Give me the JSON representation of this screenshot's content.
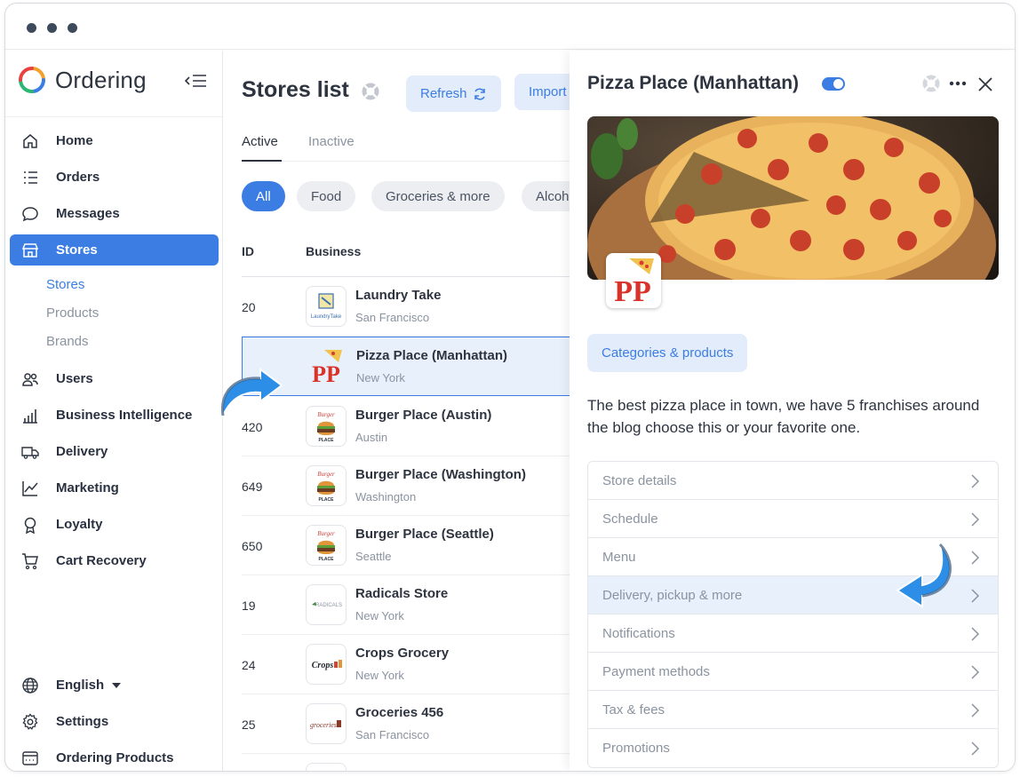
{
  "brand": {
    "name": "Ordering"
  },
  "sidebar": {
    "items": [
      {
        "label": "Home",
        "icon": "home-icon"
      },
      {
        "label": "Orders",
        "icon": "list-icon"
      },
      {
        "label": "Messages",
        "icon": "chat-icon"
      },
      {
        "label": "Stores",
        "icon": "store-icon",
        "active": true
      },
      {
        "label": "Users",
        "icon": "users-icon"
      },
      {
        "label": "Business Intelligence",
        "icon": "bar-chart-icon"
      },
      {
        "label": "Delivery",
        "icon": "truck-icon"
      },
      {
        "label": "Marketing",
        "icon": "line-chart-icon"
      },
      {
        "label": "Loyalty",
        "icon": "award-icon"
      },
      {
        "label": "Cart Recovery",
        "icon": "cart-icon"
      }
    ],
    "sub_items": [
      "Stores",
      "Products",
      "Brands"
    ],
    "footer": {
      "language": "English",
      "settings": "Settings",
      "products": "Ordering Products"
    }
  },
  "main": {
    "title": "Stores list",
    "refresh_label": "Refresh",
    "import_label": "Import",
    "tabs": [
      "Active",
      "Inactive"
    ],
    "chips": [
      "All",
      "Food",
      "Groceries & more",
      "Alcohol"
    ],
    "columns": {
      "id": "ID",
      "business": "Business"
    },
    "rows": [
      {
        "id": "20",
        "name": "Laundry Take",
        "city": "San Francisco"
      },
      {
        "id": "",
        "name": "Pizza Place (Manhattan)",
        "city": "New York"
      },
      {
        "id": "420",
        "name": "Burger Place (Austin)",
        "city": "Austin"
      },
      {
        "id": "649",
        "name": "Burger Place (Washington)",
        "city": "Washington"
      },
      {
        "id": "650",
        "name": "Burger Place (Seattle)",
        "city": "Seattle"
      },
      {
        "id": "19",
        "name": "Radicals Store",
        "city": "New York"
      },
      {
        "id": "24",
        "name": "Crops Grocery",
        "city": "New York"
      },
      {
        "id": "25",
        "name": "Groceries 456",
        "city": "San Francisco"
      }
    ],
    "logo_texts": {
      "laundry": "LaundryTake",
      "pizza": "PP",
      "burger_top": "Burger",
      "burger_bottom": "PLACE",
      "radicals": "RADICALS",
      "crops": "Crops",
      "groceries": "groceries"
    }
  },
  "panel": {
    "title": "Pizza Place (Manhattan)",
    "enabled": true,
    "categories_label": "Categories & products",
    "description": "The best pizza place in town, we have 5 franchises around the blog choose this or your favorite one.",
    "menu": [
      "Store details",
      "Schedule",
      "Menu",
      "Delivery, pickup & more",
      "Notifications",
      "Payment methods",
      "Tax & fees",
      "Promotions"
    ],
    "highlighted_menu": "Delivery, pickup & more"
  },
  "colors": {
    "accent": "#3b7de3",
    "highlight": "#e8f0fc"
  }
}
